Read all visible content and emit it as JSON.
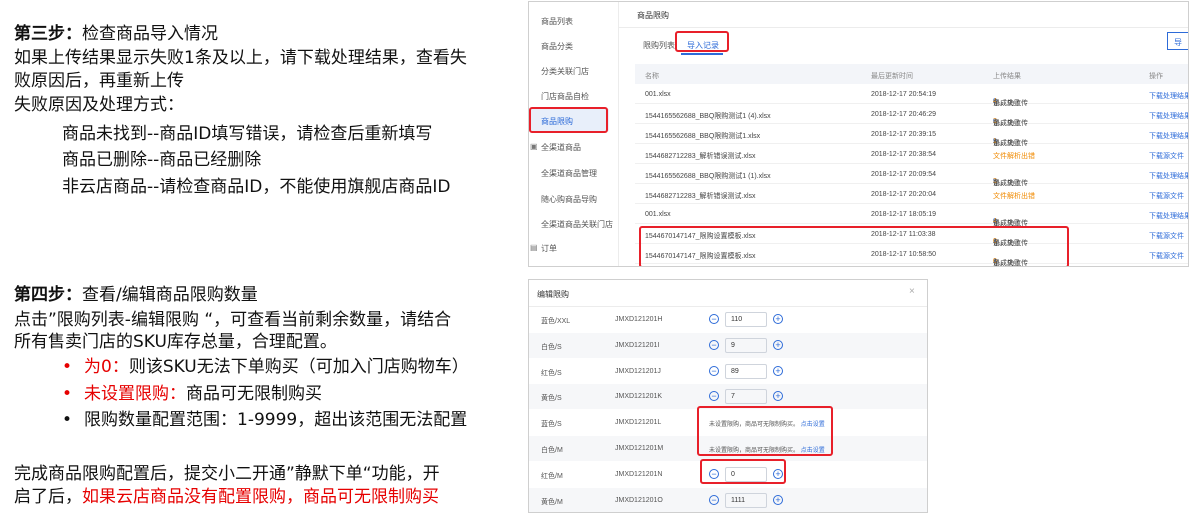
{
  "step3": {
    "heading_bold": "第三步：",
    "heading_rest": "检查商品导入情况",
    "line1": "如果上传结果显示失败1条及以上，请下载处理结果，查看失",
    "line2": "败原因后，再重新上传",
    "line3": "失败原因及处理方式：",
    "reason1": "商品未找到--商品ID填写错误，请检查后重新填写",
    "reason2": "商品已删除--商品已经删除",
    "reason3": "非云店商品--请检查商品ID，不能使用旗舰店商品ID"
  },
  "step4": {
    "heading_bold": "第四步：",
    "heading_rest": "查看/编辑商品限购数量",
    "line1": "点击”限购列表-编辑限购 “，可查看当前剩余数量，请结合",
    "line2": "所有售卖门店的SKU库存总量，合理配置。",
    "b1_red": "为0：",
    "b1_rest": "则该SKU无法下单购买（可加入门店购物车）",
    "b2_red": "未设置限购：",
    "b2_rest": "商品可无限制购买",
    "b3": "限购数量配置范围：1-9999，超出该范围无法配置",
    "bullet": "•"
  },
  "footer": {
    "line1": "完成商品限购配置后，提交小二开通”静默下单“功能，开",
    "line2_black": "启了后，",
    "line2_red": "如果云店商品没有配置限购，商品可无限制购买"
  },
  "shot1": {
    "sidebar": [
      "商品列表",
      "商品分类",
      "分类关联门店",
      "门店商品自检",
      "商品限购",
      "全渠道商品",
      "全渠道商品管理",
      "随心购商品导购",
      "全渠道商品关联门店",
      "订单"
    ],
    "page_title": "商品限购",
    "tab_list": "限购列表",
    "tab_import": "导入记录",
    "export_btn": "导",
    "columns": [
      "名称",
      "最后更新时间",
      "上传结果",
      "操作"
    ],
    "rows": [
      {
        "name": "001.xlsx",
        "time": "2018-12-17 20:54:19",
        "ok_pre": "已成功上传",
        "ok": "0",
        "mid": "条，失败",
        "fail": "4",
        "end": "条",
        "op": "下载处理结果",
        "error": ""
      },
      {
        "name": "1544165562688_BBQ限购测试1 (4).xlsx",
        "time": "2018-12-17 20:46:29",
        "ok_pre": "已成功上传",
        "ok": "0",
        "mid": "条，失败",
        "fail": "3",
        "end": "条",
        "op": "下载处理结果",
        "error": ""
      },
      {
        "name": "1544165562688_BBQ限购测试1.xlsx",
        "time": "2018-12-17 20:39:15",
        "ok_pre": "已成功上传",
        "ok": "9",
        "mid": "条，失败",
        "fail": "1",
        "end": "条",
        "op": "下载处理结果",
        "error": ""
      },
      {
        "name": "1544682712283_解析错误测试.xlsx",
        "time": "2018-12-17 20:38:54",
        "ok_pre": "",
        "ok": "",
        "mid": "",
        "fail": "",
        "end": "",
        "op": "下载源文件",
        "error": "文件解析出错"
      },
      {
        "name": "1544165562688_BBQ限购测试1 (1).xlsx",
        "time": "2018-12-17 20:09:54",
        "ok_pre": "已成功上传",
        "ok": "9",
        "mid": "条，失败",
        "fail": "3",
        "end": "条",
        "op": "下载处理结果",
        "error": ""
      },
      {
        "name": "1544682712283_解析错误测试.xlsx",
        "time": "2018-12-17 20:20:04",
        "ok_pre": "",
        "ok": "",
        "mid": "",
        "fail": "",
        "end": "",
        "op": "下载源文件",
        "error": "文件解析出错"
      },
      {
        "name": "001.xlsx",
        "time": "2018-12-17 18:05:19",
        "ok_pre": "已成功上传",
        "ok": "0",
        "mid": "条，失败",
        "fail": "4",
        "end": "条",
        "op": "下载处理结果",
        "error": ""
      },
      {
        "name": "1544670147147_限购设置模板.xlsx",
        "time": "2018-12-17 11:03:38",
        "ok_pre": "已成功上传",
        "ok": "1",
        "mid": "条，失败",
        "fail": "0",
        "end": "条",
        "op": "下载源文件",
        "error": ""
      },
      {
        "name": "1544670147147_限购设置模板.xlsx",
        "time": "2018-12-17 10:58:50",
        "ok_pre": "已成功上传",
        "ok": "1",
        "mid": "条，失败",
        "fail": "0",
        "end": "条",
        "op": "下载源文件",
        "error": ""
      }
    ]
  },
  "shot2": {
    "title": "编辑限购",
    "close": "×",
    "minus": "−",
    "plus": "+",
    "rows": [
      {
        "sku": "蓝色/XXL",
        "code": "JMXD121201H",
        "value": "110",
        "note": ""
      },
      {
        "sku": "白色/S",
        "code": "JMXD121201I",
        "value": "9",
        "note": ""
      },
      {
        "sku": "红色/S",
        "code": "JMXD121201J",
        "value": "89",
        "note": ""
      },
      {
        "sku": "黄色/S",
        "code": "JMXD121201K",
        "value": "7",
        "note": ""
      },
      {
        "sku": "蓝色/S",
        "code": "JMXD121201L",
        "value": "",
        "note": "未设置限购，商品可无限制购买。",
        "link": "点击设置"
      },
      {
        "sku": "白色/M",
        "code": "JMXD121201M",
        "value": "",
        "note": "未设置限购，商品可无限制购买。",
        "link": "点击设置"
      },
      {
        "sku": "红色/M",
        "code": "JMXD121201N",
        "value": "0",
        "note": ""
      },
      {
        "sku": "黄色/M",
        "code": "JMXD121201O",
        "value": "1111",
        "note": ""
      }
    ]
  }
}
